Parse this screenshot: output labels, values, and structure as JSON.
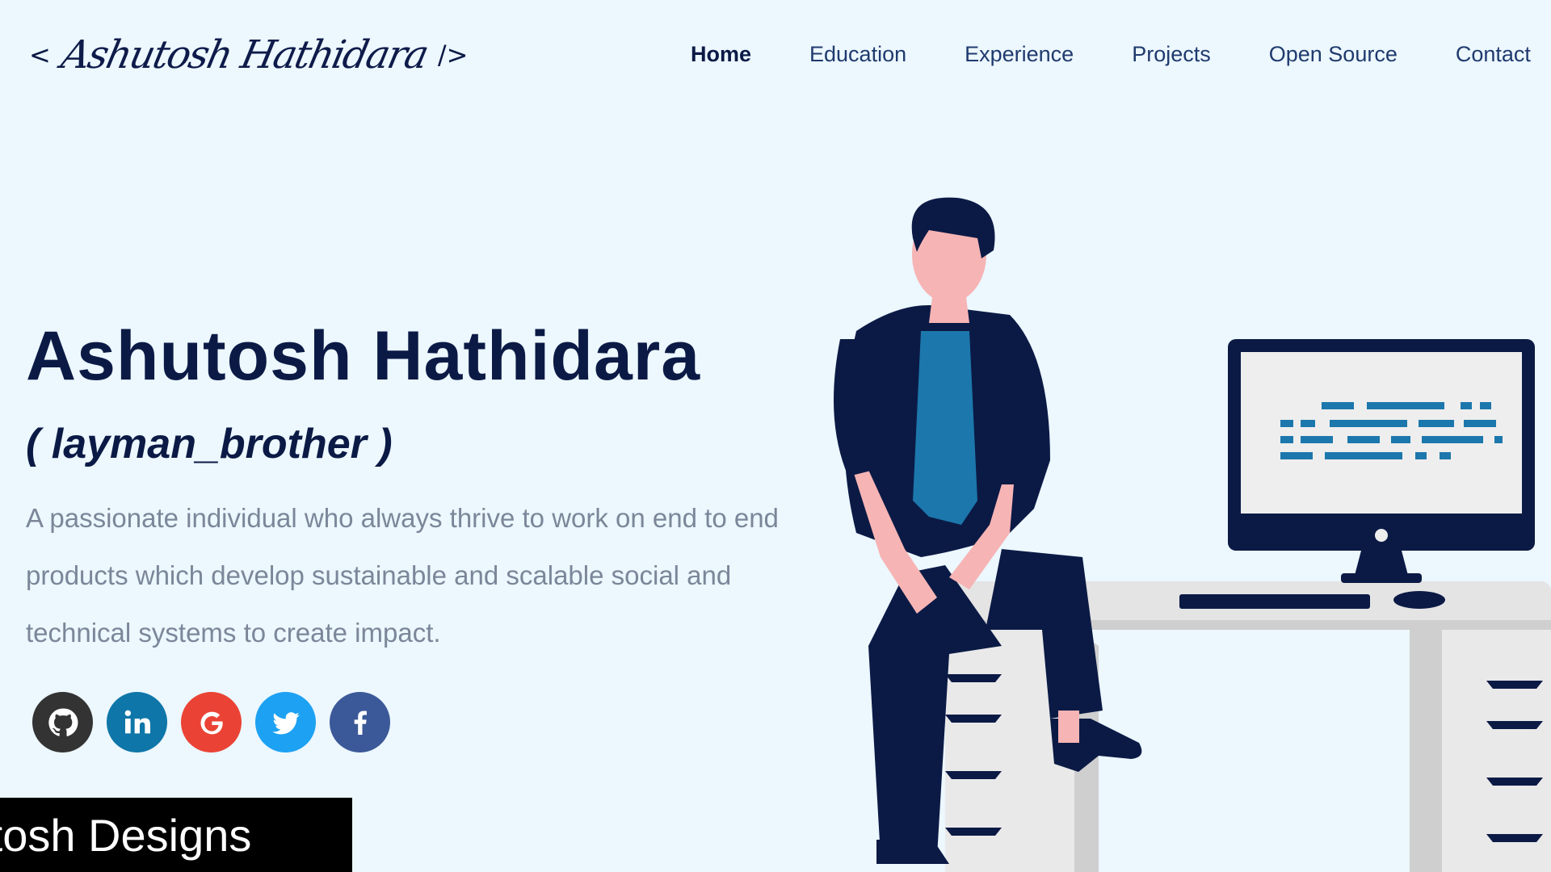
{
  "header": {
    "logo_open": "<",
    "logo_signature": "Ashutosh Hathidara",
    "logo_close": "/>",
    "nav": [
      "Home",
      "Education",
      "Experience",
      "Projects",
      "Open Source",
      "Contact"
    ]
  },
  "hero": {
    "name": "Ashutosh Hathidara",
    "alias": "( layman_brother )",
    "bio": "A passionate individual who always thrive to work on end to end products which develop sustainable and scalable social and technical systems to create impact."
  },
  "social": [
    {
      "icon": "github-icon",
      "color": "#333333"
    },
    {
      "icon": "linkedin-icon",
      "color": "#0e76a8"
    },
    {
      "icon": "google-icon",
      "color": "#ea4335"
    },
    {
      "icon": "twitter-icon",
      "color": "#1da1f2"
    },
    {
      "icon": "facebook-icon",
      "color": "#3b5998"
    }
  ],
  "brand_banner": "Ashutosh Designs",
  "colors": {
    "background": "#ecf7fe",
    "primary_text": "#0b1a45",
    "secondary_text": "#7b8799",
    "shirt": "#1c77ac"
  }
}
